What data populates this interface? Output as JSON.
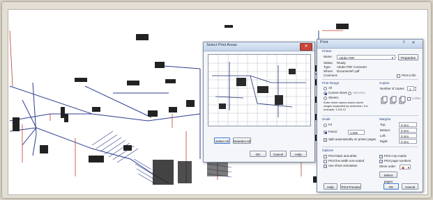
{
  "select_print_area": {
    "title": "Select Print Areas",
    "select_all_label": "Select All",
    "deselect_all_label": "Deselect All",
    "ok_label": "OK",
    "cancel_label": "Cancel",
    "help_label": "Help"
  },
  "print_dialog": {
    "title": "Print",
    "printer_section": "Printer",
    "name_label": "Name:",
    "name_value": "Adobe PDF",
    "properties_label": "Properties",
    "status_label": "Status:",
    "status_value": "Ready",
    "type_label": "Type:",
    "type_value": "Adobe PDF Converter",
    "where_label": "Where:",
    "where_value": "Documents\\*.pdf",
    "comment_label": "Comment:",
    "print_to_file_label": "Print to file",
    "print_range_section": "Print Range",
    "all_label": "All",
    "current_sheet_label": "Current sheet",
    "selection_label": "Selection",
    "sheets_label": "Sheets:",
    "sheets_hint": "Enter sheet names and/or sheet ranges separated by semicolon. For example, 1;3;5-12",
    "copies_section": "Copies",
    "number_of_copies_label": "Number of copies:",
    "number_of_copies_value": "1",
    "collate_label": "Collate",
    "scale_section": "Scale",
    "fit_label": "Fit",
    "factor_label": "Factor:",
    "factor_value": "1.000",
    "split_label": "Split automatically on printer pages",
    "margins_section": "Margins",
    "top_label": "Top:",
    "top_value": "0 mm",
    "bottom_label": "Bottom:",
    "bottom_value": "0 mm",
    "left_label": "Left:",
    "left_value": "0 mm",
    "right_label": "Right:",
    "right_value": "0 mm",
    "options_section": "Options",
    "print_black_white_label": "Print black and white",
    "print_line_width_label": "Print line width non-scaled",
    "use_sheet_orientation_label": "Use sheet orientation",
    "print_crop_marks_label": "Print crop marks",
    "print_page_numbers_label": "Print page numbers",
    "sheet_order_label": "Sheet order:",
    "select_pages_label": "Select pages",
    "help_label": "Help",
    "print_preview_label": "Print Preview",
    "ok_label": "OK",
    "cancel_label": "Cancel"
  },
  "colors": {
    "wire_blue": "#2c3d8f",
    "wire_red": "#c0392b",
    "dialog_bg": "#f4f6fa",
    "close_red": "#c8473a"
  }
}
